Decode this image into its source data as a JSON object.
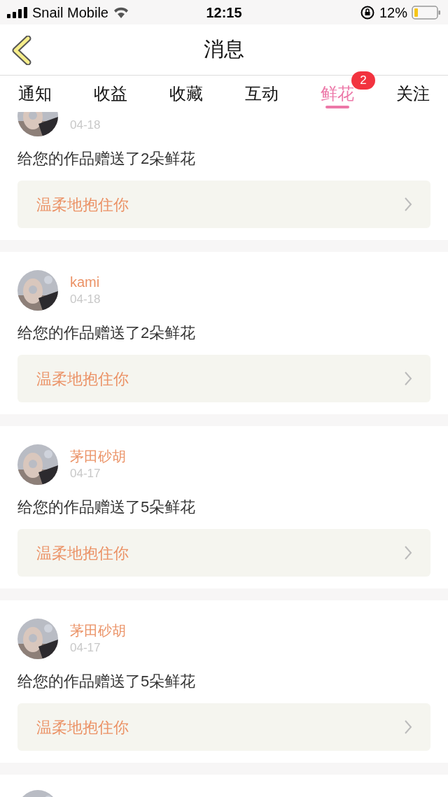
{
  "status_bar": {
    "carrier": "Snail Mobile",
    "time": "12:15",
    "battery": "12%"
  },
  "nav": {
    "title": "消息"
  },
  "tabs": [
    {
      "label": "通知",
      "selected": false
    },
    {
      "label": "收益",
      "selected": false
    },
    {
      "label": "收藏",
      "selected": false
    },
    {
      "label": "互动",
      "selected": false
    },
    {
      "label": "鲜花",
      "selected": true,
      "badge": "2"
    },
    {
      "label": "关注",
      "selected": false
    }
  ],
  "messages": [
    {
      "kind": "message",
      "date": "04-18",
      "text": "给您的作品赠送了2朵鲜花",
      "reply": "温柔地抱住你"
    },
    {
      "kind": "message",
      "name": "kami",
      "date": "04-18",
      "text": "给您的作品赠送了2朵鲜花",
      "reply": "温柔地抱住你"
    },
    {
      "kind": "message",
      "name": "茅田砂胡",
      "date": "04-17",
      "text": "给您的作品赠送了5朵鲜花",
      "reply": "温柔地抱住你"
    },
    {
      "kind": "message",
      "name": "茅田砂胡",
      "date": "04-17",
      "text": "给您的作品赠送了5朵鲜花",
      "reply": "温柔地抱住你"
    },
    {
      "kind": "avatar-only"
    }
  ]
}
